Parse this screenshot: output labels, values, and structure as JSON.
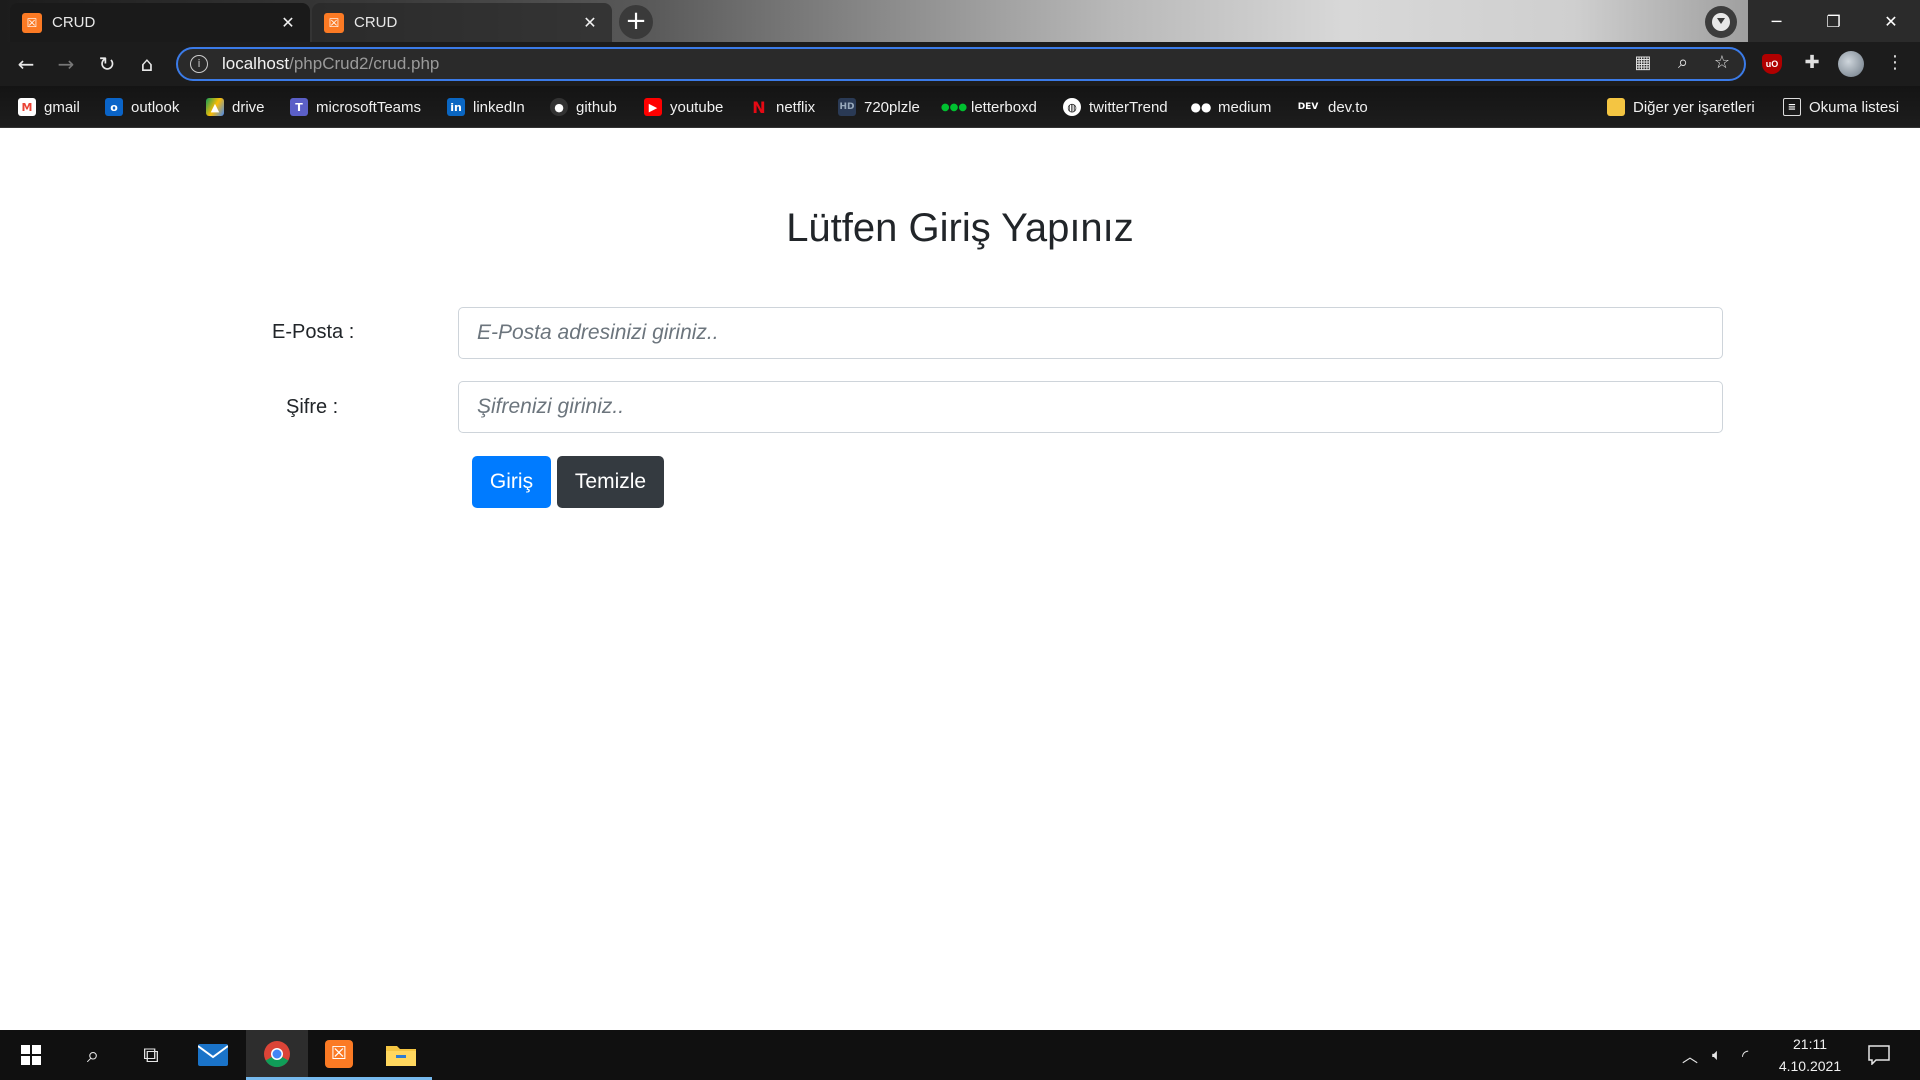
{
  "browser": {
    "tabs": [
      {
        "label": "CRUD",
        "favicon": "xampp-icon",
        "active": true
      },
      {
        "label": "CRUD",
        "favicon": "xampp-icon",
        "active": false
      }
    ],
    "address": {
      "host": "localhost",
      "path": "/phpCrud2/crud.php"
    },
    "bookmarks": [
      {
        "label": "gmail",
        "icon": "gmail-icon",
        "color": "#ea4335"
      },
      {
        "label": "outlook",
        "icon": "outlook-icon",
        "color": "#0a64c8"
      },
      {
        "label": "drive",
        "icon": "drive-icon",
        "color": "#fbbc04"
      },
      {
        "label": "microsoftTeams",
        "icon": "teams-icon",
        "color": "#5b5fc7"
      },
      {
        "label": "linkedIn",
        "icon": "linkedin-icon",
        "color": "#0a66c2"
      },
      {
        "label": "github",
        "icon": "github-icon",
        "color": "#333333"
      },
      {
        "label": "youtube",
        "icon": "youtube-icon",
        "color": "#ff0000"
      },
      {
        "label": "netflix",
        "icon": "netflix-icon",
        "color": "#e50914"
      },
      {
        "label": "720plzle",
        "icon": "hd-icon",
        "color": "#4a6fa5"
      },
      {
        "label": "letterboxd",
        "icon": "letterboxd-icon",
        "color": "#00c030"
      },
      {
        "label": "twitterTrend",
        "icon": "globe-icon",
        "color": "#ffffff"
      },
      {
        "label": "medium",
        "icon": "medium-icon",
        "color": "#ffffff"
      },
      {
        "label": "dev.to",
        "icon": "dev-icon",
        "color": "#000000"
      }
    ],
    "other_bookmarks": "Diğer yer işaretleri",
    "reading_list": "Okuma listesi"
  },
  "page": {
    "heading": "Lütfen Giriş Yapınız",
    "email_label": "E-Posta :",
    "email_placeholder": "E-Posta adresinizi giriniz..",
    "password_label": "Şifre :",
    "password_placeholder": "Şifrenizi giriniz..",
    "login_button": "Giriş",
    "clear_button": "Temizle",
    "primary_color": "#007bff",
    "dark_color": "#343a40"
  },
  "taskbar": {
    "time": "21:11",
    "date": "4.10.2021"
  }
}
